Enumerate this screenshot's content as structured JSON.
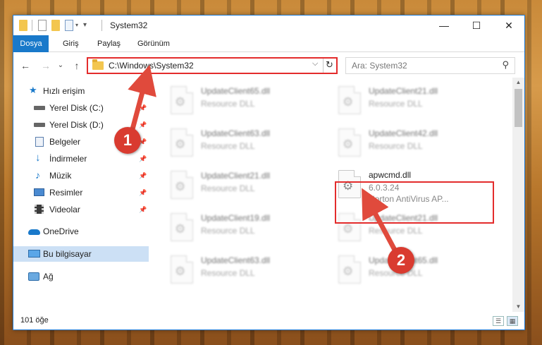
{
  "window": {
    "title": "System32",
    "controls": {
      "minimize": "—",
      "maximize": "☐",
      "close": "✕"
    }
  },
  "ribbon": {
    "tabs": [
      {
        "label": "Dosya"
      },
      {
        "label": "Giriş"
      },
      {
        "label": "Paylaş"
      },
      {
        "label": "Görünüm"
      }
    ]
  },
  "address": {
    "path": "C:\\Windows\\System32",
    "dropdown": "⌵",
    "refresh": "↻"
  },
  "search": {
    "placeholder": "Ara: System32",
    "icon": "⚲"
  },
  "nav": {
    "back": "←",
    "forward": "→",
    "up_history": "⌄",
    "up": "↑",
    "items": [
      {
        "label": "Hızlı erişim",
        "icon": "star-icon",
        "pinned": false
      },
      {
        "label": "Yerel Disk (C:)",
        "icon": "drive-icon",
        "pinned": true
      },
      {
        "label": "Yerel Disk (D:)",
        "icon": "drive-icon",
        "pinned": true
      },
      {
        "label": "Belgeler",
        "icon": "documents-icon",
        "pinned": true
      },
      {
        "label": "İndirmeler",
        "icon": "download-icon",
        "pinned": true
      },
      {
        "label": "Müzik",
        "icon": "music-icon",
        "pinned": true
      },
      {
        "label": "Resimler",
        "icon": "pictures-icon",
        "pinned": true
      },
      {
        "label": "Videolar",
        "icon": "videos-icon",
        "pinned": true
      },
      {
        "label": "OneDrive",
        "icon": "cloud-icon",
        "pinned": false
      },
      {
        "label": "Bu bilgisayar",
        "icon": "computer-icon",
        "pinned": false,
        "selected": true
      },
      {
        "label": "Ağ",
        "icon": "network-icon",
        "pinned": false
      }
    ],
    "pin_glyph": "📌"
  },
  "files": [
    {
      "name": "UpdateClient65.dll",
      "type": "Resource DLL",
      "blurred": true
    },
    {
      "name": "UpdateClient21.dll",
      "type": "Resource DLL",
      "blurred": true
    },
    {
      "name": "UpdateClient63.dll",
      "type": "Resource DLL",
      "blurred": true
    },
    {
      "name": "UpdateClient42.dll",
      "type": "Resource DLL",
      "blurred": true
    },
    {
      "name": "UpdateClient21.dll",
      "type": "Resource DLL",
      "blurred": true
    },
    {
      "name": "apwcmd.dll",
      "version": "6.0.3.24",
      "type": "Norton AntiVirus AP...",
      "blurred": false,
      "highlighted": true
    },
    {
      "name": "UpdateClient19.dll",
      "type": "Resource DLL",
      "blurred": true
    },
    {
      "name": "UpdateClient21.dll",
      "type": "Resource DLL",
      "blurred": true
    },
    {
      "name": "UpdateClient63.dll",
      "type": "Resource DLL",
      "blurred": true
    },
    {
      "name": "UpdateClient65.dll",
      "type": "Resource DLL",
      "blurred": true
    }
  ],
  "status": {
    "count": "101 öğe"
  },
  "callouts": [
    {
      "label": "1"
    },
    {
      "label": "2"
    }
  ],
  "colors": {
    "accent": "#1979ca",
    "highlight": "#e32c2c",
    "callout": "#d93b30"
  }
}
